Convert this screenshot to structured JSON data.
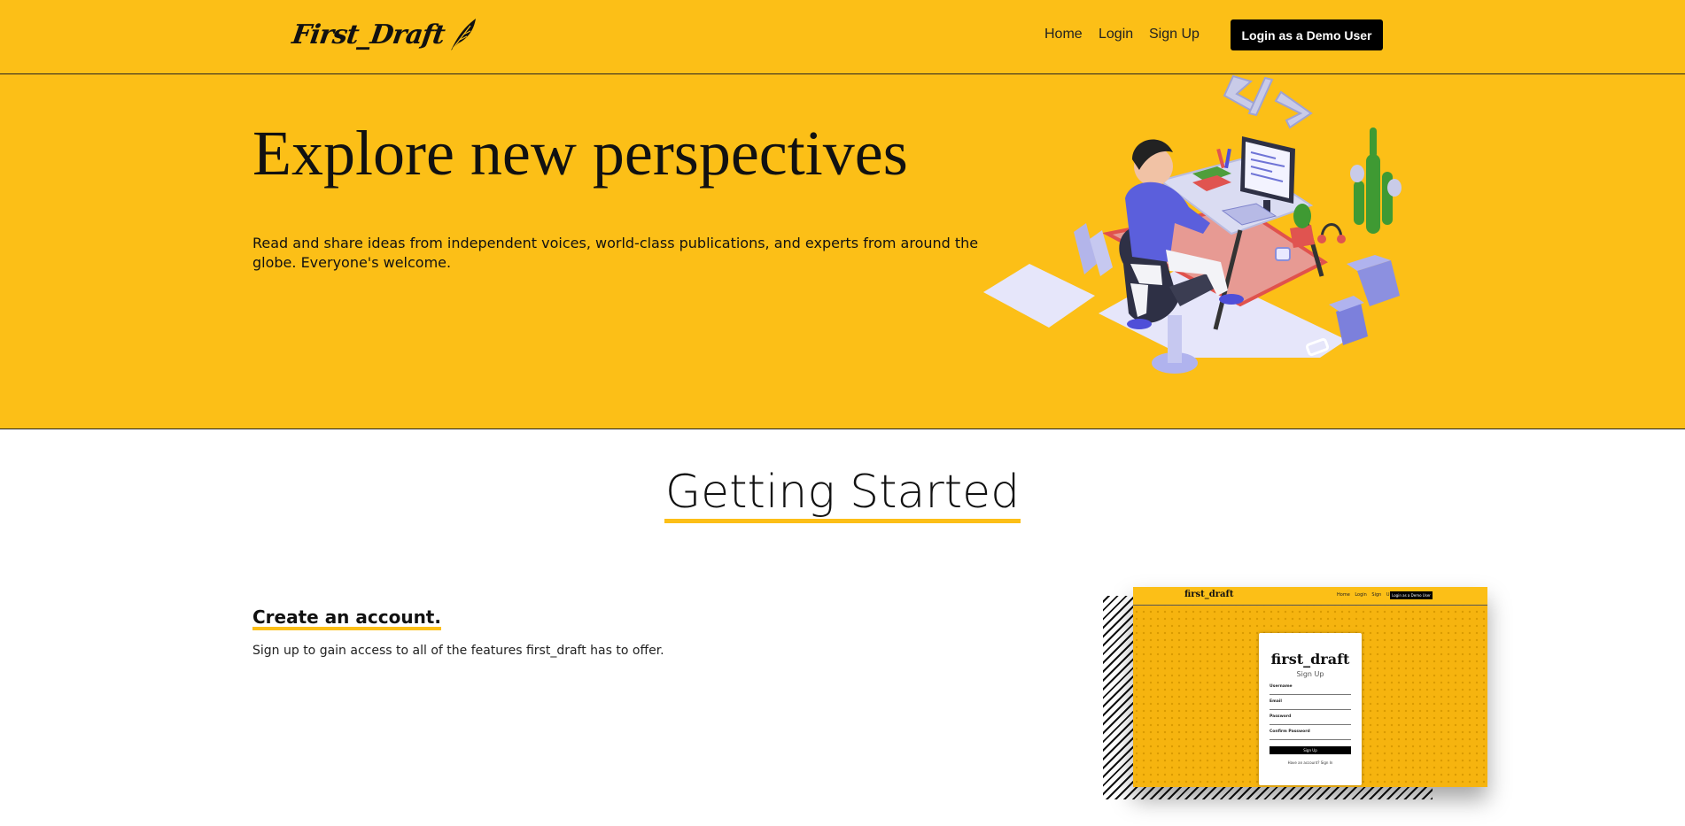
{
  "header": {
    "logo_text": "First_Draft",
    "nav": {
      "home": "Home",
      "login": "Login",
      "signup": "Sign Up"
    },
    "demo_button": "Login as a Demo User"
  },
  "hero": {
    "title": "Explore new perspectives",
    "subtitle": "Read and share ideas from independent voices, world-class publications, and experts from around the globe. Everyone's welcome."
  },
  "getting_started": {
    "title": "Getting Started",
    "step": {
      "title": "Create an account.",
      "text": "Sign up to gain access to all of the features first_draft has to offer."
    },
    "preview": {
      "logo": "first_draft",
      "nav": "Home Login Sign Up",
      "demo_button": "Login as a Demo User",
      "card_title": "first_draft",
      "card_subtitle": "Sign Up",
      "fields": [
        "Username",
        "Email",
        "Password",
        "Confirm Password"
      ],
      "submit": "Sign Up",
      "footer": "Have an account? Sign In"
    }
  },
  "colors": {
    "accent": "#fcbf17",
    "text": "#111111",
    "button": "#000000"
  }
}
